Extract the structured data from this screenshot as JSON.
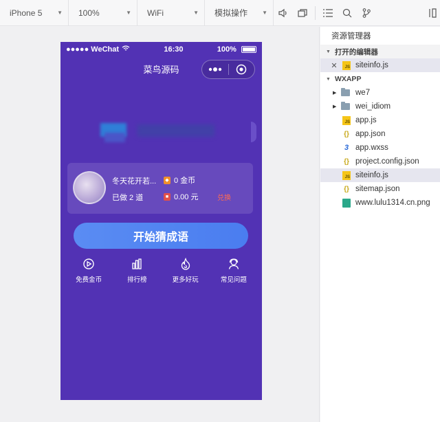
{
  "toolbar": {
    "device": "iPhone 5",
    "zoom": "100%",
    "network": "WiFi",
    "mode": "模拟操作"
  },
  "phone": {
    "status": {
      "carrier": "●●●●● WeChat",
      "time": "16:30",
      "battery": "100%"
    },
    "nav_title": "菜鸟源码",
    "user": {
      "name": "冬天花开若...",
      "done": "已做 2 道",
      "coins": "0 金币",
      "money": "0.00 元",
      "exchange": "兑换"
    },
    "start_button": "开始猜成语",
    "features": [
      {
        "label": "免费金币",
        "icon": "play-circle-icon"
      },
      {
        "label": "排行榜",
        "icon": "bar-chart-icon"
      },
      {
        "label": "更多好玩",
        "icon": "flame-icon"
      },
      {
        "label": "常见问题",
        "icon": "support-person-icon"
      }
    ]
  },
  "explorer": {
    "title": "资源管理器",
    "open_editors_label": "打开的编辑器",
    "open_file": "siteinfo.js",
    "project_label": "WXAPP",
    "folders": [
      "we7",
      "wei_idiom"
    ],
    "files": [
      {
        "name": "app.js",
        "type": "js"
      },
      {
        "name": "app.json",
        "type": "json"
      },
      {
        "name": "app.wxss",
        "type": "wxss"
      },
      {
        "name": "project.config.json",
        "type": "json"
      },
      {
        "name": "siteinfo.js",
        "type": "js",
        "selected": true
      },
      {
        "name": "sitemap.json",
        "type": "json"
      },
      {
        "name": "www.lulu1314.cn.png",
        "type": "png"
      }
    ]
  }
}
